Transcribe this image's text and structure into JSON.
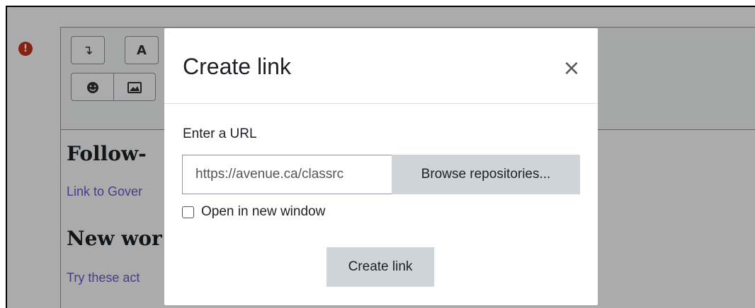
{
  "modal": {
    "title": "Create link",
    "close_glyph": "×",
    "url_label": "Enter a URL",
    "url_value": "https://avenue.ca/classrc",
    "browse_label": "Browse repositories...",
    "new_window_label": "Open in new window",
    "new_window_checked": false,
    "submit_label": "Create link"
  },
  "background": {
    "error_glyph": "!",
    "toolbar": {
      "btn1_glyph": "↴",
      "btn2_glyph": "A",
      "emoji_icon": "smiley-icon",
      "image_icon": "image-icon"
    },
    "heading1": "Follow-",
    "sublink1": "Link to Gover",
    "heading2": "New wor",
    "subtext2": "Try these act"
  },
  "colors": {
    "error": "#ca3120",
    "button_bg": "#ced4da",
    "link_text": "#6a5acd"
  }
}
